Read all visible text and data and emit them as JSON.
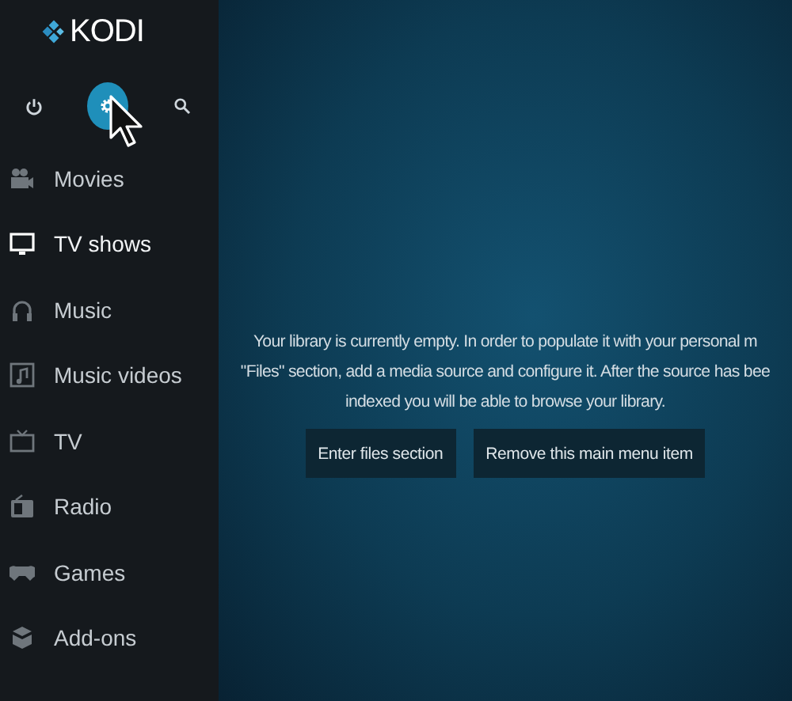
{
  "logo": {
    "text": "KODI"
  },
  "toolbar": [
    {
      "kind": "power",
      "selected": false
    },
    {
      "kind": "settings",
      "selected": true
    },
    {
      "kind": "search",
      "selected": false
    }
  ],
  "menu": [
    {
      "kind": "movies",
      "label": "Movies",
      "selected": false
    },
    {
      "kind": "tv-shows",
      "label": "TV shows",
      "selected": true
    },
    {
      "kind": "music",
      "label": "Music",
      "selected": false
    },
    {
      "kind": "music-videos",
      "label": "Music videos",
      "selected": false
    },
    {
      "kind": "tv",
      "label": "TV",
      "selected": false
    },
    {
      "kind": "radio",
      "label": "Radio",
      "selected": false
    },
    {
      "kind": "games",
      "label": "Games",
      "selected": false
    },
    {
      "kind": "add-ons",
      "label": "Add-ons",
      "selected": false
    }
  ],
  "message": [
    "Your library is currently empty. In order to populate it with your personal m",
    "\"Files\" section, add a media source and configure it. After the source has bee",
    "indexed you will be able to browse your library."
  ],
  "buttons": [
    "Enter files section",
    "Remove this main menu item"
  ]
}
